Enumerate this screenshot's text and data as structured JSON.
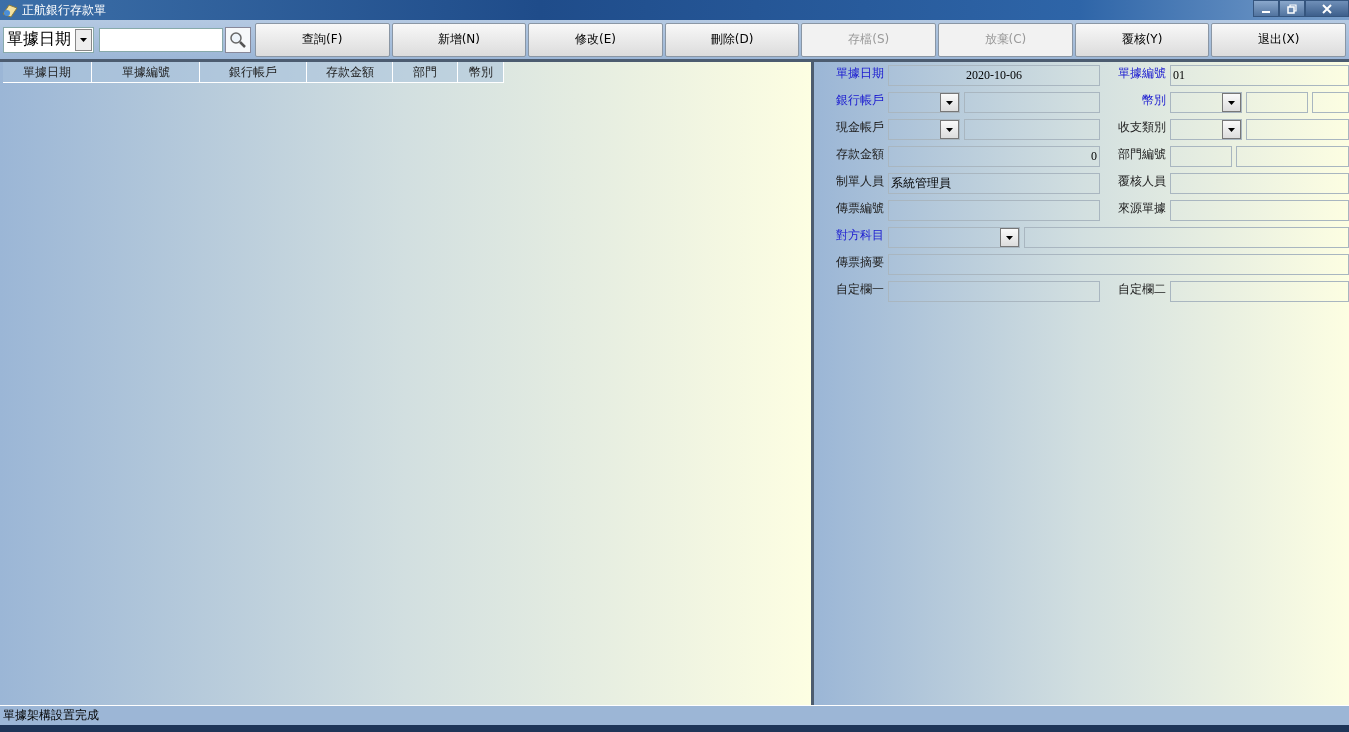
{
  "window": {
    "title": "正航銀行存款單"
  },
  "toolbar": {
    "filter": {
      "value": "單據日期"
    },
    "buttons": [
      {
        "label": "查詢(F)",
        "disabled": false
      },
      {
        "label": "新增(N)",
        "disabled": false
      },
      {
        "label": "修改(E)",
        "disabled": false
      },
      {
        "label": "刪除(D)",
        "disabled": false
      },
      {
        "label": "存檔(S)",
        "disabled": true
      },
      {
        "label": "放棄(C)",
        "disabled": true
      },
      {
        "label": "覆核(Y)",
        "disabled": false
      },
      {
        "label": "退出(X)",
        "disabled": false
      }
    ]
  },
  "table": {
    "columns": [
      "單據日期",
      "單據編號",
      "銀行帳戶",
      "存款金額",
      "部門",
      "幣別"
    ]
  },
  "form": {
    "rows": [
      {
        "cells": [
          {
            "label": "單據日期",
            "required": true,
            "fields": [
              {
                "kind": "date",
                "value": "2020-10-06"
              }
            ]
          },
          {
            "label": "單據編號",
            "required": true,
            "fields": [
              {
                "kind": "box",
                "value": "01"
              }
            ]
          }
        ]
      },
      {
        "cells": [
          {
            "label": "銀行帳戶",
            "required": true,
            "fields": [
              {
                "kind": "combo"
              },
              {
                "kind": "box"
              }
            ]
          },
          {
            "label": "幣別",
            "required": true,
            "fields": [
              {
                "kind": "combo"
              },
              {
                "kind": "code"
              },
              {
                "kind": "box"
              }
            ]
          }
        ]
      },
      {
        "cells": [
          {
            "label": "現金帳戶",
            "required": false,
            "fields": [
              {
                "kind": "combo"
              },
              {
                "kind": "box"
              }
            ]
          },
          {
            "label": "收支類別",
            "required": false,
            "fields": [
              {
                "kind": "combo"
              },
              {
                "kind": "box"
              }
            ]
          }
        ]
      },
      {
        "cells": [
          {
            "label": "存款金額",
            "required": false,
            "fields": [
              {
                "kind": "amount",
                "value": "0"
              }
            ]
          },
          {
            "label": "部門編號",
            "required": false,
            "fields": [
              {
                "kind": "code"
              },
              {
                "kind": "box"
              }
            ]
          }
        ]
      },
      {
        "cells": [
          {
            "label": "制單人員",
            "required": false,
            "fields": [
              {
                "kind": "box",
                "value": "系統管理員"
              }
            ]
          },
          {
            "label": "覆核人員",
            "required": false,
            "fields": [
              {
                "kind": "box"
              }
            ]
          }
        ]
      },
      {
        "cells": [
          {
            "label": "傳票編號",
            "required": false,
            "fields": [
              {
                "kind": "box"
              }
            ]
          },
          {
            "label": "來源單據",
            "required": false,
            "fields": [
              {
                "kind": "box"
              }
            ]
          }
        ]
      },
      {
        "cells": [
          {
            "label": "對方科目",
            "required": true,
            "fields": [
              {
                "kind": "wide-combo"
              },
              {
                "kind": "box"
              }
            ]
          }
        ]
      },
      {
        "cells": [
          {
            "label": "傳票摘要",
            "required": false,
            "fields": [
              {
                "kind": "box"
              }
            ]
          }
        ]
      },
      {
        "cells": [
          {
            "label": "自定欄一",
            "required": false,
            "fields": [
              {
                "kind": "box"
              }
            ]
          },
          {
            "label": "自定欄二",
            "required": false,
            "fields": [
              {
                "kind": "box"
              }
            ]
          }
        ]
      }
    ]
  },
  "status_bar": {
    "message": "單據架構設置完成"
  }
}
